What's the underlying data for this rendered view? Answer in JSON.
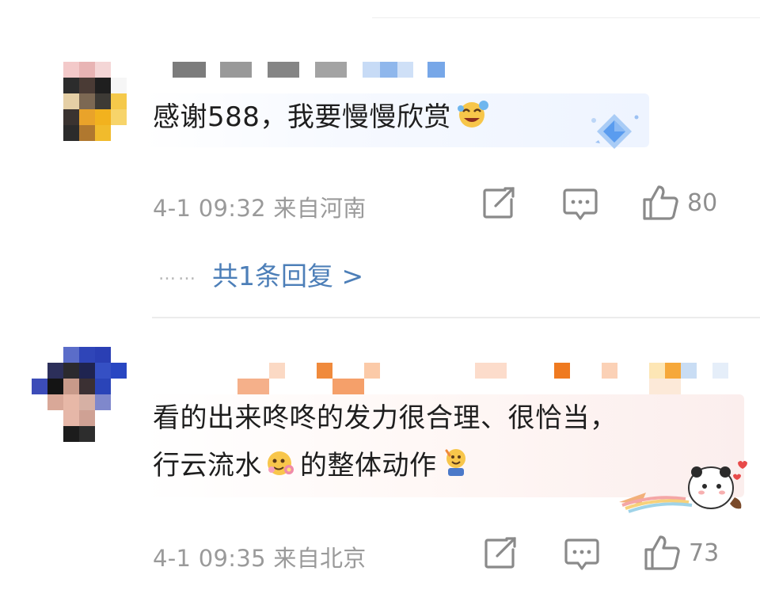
{
  "comments": [
    {
      "text": "感谢588，我要慢慢欣赏",
      "timestamp": "4-1 09:32",
      "location": "来自河南",
      "like_count": "80",
      "reply_link": "共1条回复 >",
      "reply_dots": "……",
      "inline_emoji": "laughing-tears-emoji"
    },
    {
      "text_line1": "看的出来咚咚的发力很合理、很恰当，",
      "text_line2a": "行云流水",
      "text_line2b": "的整体动作",
      "timestamp": "4-1 09:35",
      "location": "来自北京",
      "like_count": "73",
      "inline_emojis": [
        "flower-face-emoji",
        "cheer-emoji"
      ]
    }
  ],
  "icons": {
    "share": "share-icon",
    "comment": "comment-icon",
    "like": "thumbs-up-icon"
  },
  "colors": {
    "reply_link": "#4d7fb8",
    "meta_text": "#9a9a9a",
    "body_text": "#1e1e1e"
  }
}
